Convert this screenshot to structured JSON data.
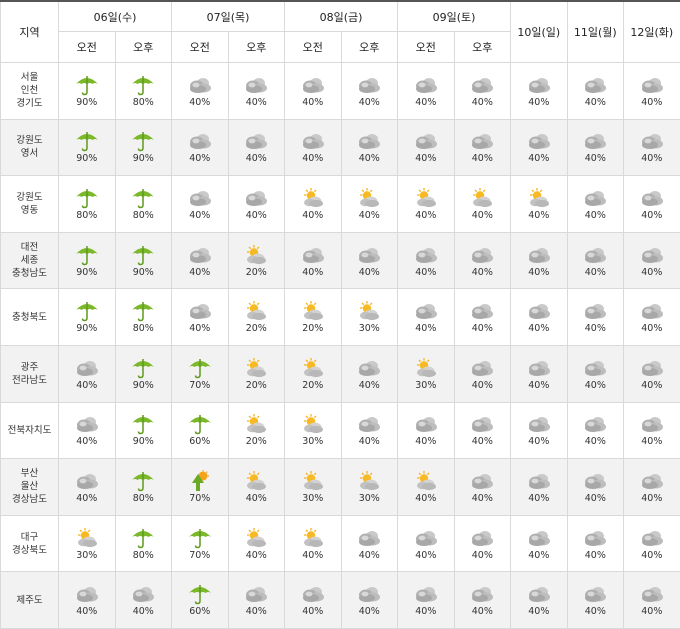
{
  "header": {
    "region_label": "지역",
    "days_am_pm": [
      "06일(수)",
      "07일(목)",
      "08일(금)",
      "09일(토)"
    ],
    "am_label": "오전",
    "pm_label": "오후",
    "days_single": [
      "10일(일)",
      "11일(월)",
      "12일(화)"
    ]
  },
  "icon_names": {
    "rain": "umbrella-rain-icon",
    "cloud": "cloudy-icon",
    "partly": "partly-cloudy-icon",
    "shower": "rain-shower-icon"
  },
  "colors": {
    "rain": "#7bb82a",
    "sun": "#f5b21c",
    "cloud": "#b5b5b5"
  },
  "rows": [
    {
      "region": [
        "서울",
        "인천",
        "경기도"
      ],
      "cells": [
        {
          "icon": "rain",
          "pct": "90%"
        },
        {
          "icon": "rain",
          "pct": "80%"
        },
        {
          "icon": "cloud",
          "pct": "40%"
        },
        {
          "icon": "cloud",
          "pct": "40%"
        },
        {
          "icon": "cloud",
          "pct": "40%"
        },
        {
          "icon": "cloud",
          "pct": "40%"
        },
        {
          "icon": "cloud",
          "pct": "40%"
        },
        {
          "icon": "cloud",
          "pct": "40%"
        },
        {
          "icon": "cloud",
          "pct": "40%"
        },
        {
          "icon": "cloud",
          "pct": "40%"
        },
        {
          "icon": "cloud",
          "pct": "40%"
        }
      ]
    },
    {
      "region": [
        "강원도",
        "영서"
      ],
      "cells": [
        {
          "icon": "rain",
          "pct": "90%"
        },
        {
          "icon": "rain",
          "pct": "90%"
        },
        {
          "icon": "cloud",
          "pct": "40%"
        },
        {
          "icon": "cloud",
          "pct": "40%"
        },
        {
          "icon": "cloud",
          "pct": "40%"
        },
        {
          "icon": "cloud",
          "pct": "40%"
        },
        {
          "icon": "cloud",
          "pct": "40%"
        },
        {
          "icon": "cloud",
          "pct": "40%"
        },
        {
          "icon": "cloud",
          "pct": "40%"
        },
        {
          "icon": "cloud",
          "pct": "40%"
        },
        {
          "icon": "cloud",
          "pct": "40%"
        }
      ]
    },
    {
      "region": [
        "강원도",
        "영동"
      ],
      "cells": [
        {
          "icon": "rain",
          "pct": "80%"
        },
        {
          "icon": "rain",
          "pct": "80%"
        },
        {
          "icon": "cloud",
          "pct": "40%"
        },
        {
          "icon": "cloud",
          "pct": "40%"
        },
        {
          "icon": "partly",
          "pct": "40%"
        },
        {
          "icon": "partly",
          "pct": "40%"
        },
        {
          "icon": "partly",
          "pct": "40%"
        },
        {
          "icon": "partly",
          "pct": "40%"
        },
        {
          "icon": "partly",
          "pct": "40%"
        },
        {
          "icon": "cloud",
          "pct": "40%"
        },
        {
          "icon": "cloud",
          "pct": "40%"
        }
      ]
    },
    {
      "region": [
        "대전",
        "세종",
        "충청남도"
      ],
      "cells": [
        {
          "icon": "rain",
          "pct": "90%"
        },
        {
          "icon": "rain",
          "pct": "90%"
        },
        {
          "icon": "cloud",
          "pct": "40%"
        },
        {
          "icon": "partly",
          "pct": "20%"
        },
        {
          "icon": "cloud",
          "pct": "40%"
        },
        {
          "icon": "cloud",
          "pct": "40%"
        },
        {
          "icon": "cloud",
          "pct": "40%"
        },
        {
          "icon": "cloud",
          "pct": "40%"
        },
        {
          "icon": "cloud",
          "pct": "40%"
        },
        {
          "icon": "cloud",
          "pct": "40%"
        },
        {
          "icon": "cloud",
          "pct": "40%"
        }
      ]
    },
    {
      "region": [
        "충청북도"
      ],
      "cells": [
        {
          "icon": "rain",
          "pct": "90%"
        },
        {
          "icon": "rain",
          "pct": "80%"
        },
        {
          "icon": "cloud",
          "pct": "40%"
        },
        {
          "icon": "partly",
          "pct": "20%"
        },
        {
          "icon": "partly",
          "pct": "20%"
        },
        {
          "icon": "partly",
          "pct": "30%"
        },
        {
          "icon": "cloud",
          "pct": "40%"
        },
        {
          "icon": "cloud",
          "pct": "40%"
        },
        {
          "icon": "cloud",
          "pct": "40%"
        },
        {
          "icon": "cloud",
          "pct": "40%"
        },
        {
          "icon": "cloud",
          "pct": "40%"
        }
      ]
    },
    {
      "region": [
        "광주",
        "전라남도"
      ],
      "cells": [
        {
          "icon": "cloud",
          "pct": "40%"
        },
        {
          "icon": "rain",
          "pct": "90%"
        },
        {
          "icon": "rain",
          "pct": "70%"
        },
        {
          "icon": "partly",
          "pct": "20%"
        },
        {
          "icon": "partly",
          "pct": "20%"
        },
        {
          "icon": "cloud",
          "pct": "40%"
        },
        {
          "icon": "partly",
          "pct": "30%"
        },
        {
          "icon": "cloud",
          "pct": "40%"
        },
        {
          "icon": "cloud",
          "pct": "40%"
        },
        {
          "icon": "cloud",
          "pct": "40%"
        },
        {
          "icon": "cloud",
          "pct": "40%"
        }
      ]
    },
    {
      "region": [
        "전북자치도"
      ],
      "cells": [
        {
          "icon": "cloud",
          "pct": "40%"
        },
        {
          "icon": "rain",
          "pct": "90%"
        },
        {
          "icon": "rain",
          "pct": "60%"
        },
        {
          "icon": "partly",
          "pct": "20%"
        },
        {
          "icon": "partly",
          "pct": "30%"
        },
        {
          "icon": "cloud",
          "pct": "40%"
        },
        {
          "icon": "cloud",
          "pct": "40%"
        },
        {
          "icon": "cloud",
          "pct": "40%"
        },
        {
          "icon": "cloud",
          "pct": "40%"
        },
        {
          "icon": "cloud",
          "pct": "40%"
        },
        {
          "icon": "cloud",
          "pct": "40%"
        }
      ]
    },
    {
      "region": [
        "부산",
        "울산",
        "경상남도"
      ],
      "cells": [
        {
          "icon": "cloud",
          "pct": "40%"
        },
        {
          "icon": "rain",
          "pct": "80%"
        },
        {
          "icon": "shower",
          "pct": "70%"
        },
        {
          "icon": "partly",
          "pct": "40%"
        },
        {
          "icon": "partly",
          "pct": "30%"
        },
        {
          "icon": "partly",
          "pct": "30%"
        },
        {
          "icon": "partly",
          "pct": "40%"
        },
        {
          "icon": "cloud",
          "pct": "40%"
        },
        {
          "icon": "cloud",
          "pct": "40%"
        },
        {
          "icon": "cloud",
          "pct": "40%"
        },
        {
          "icon": "cloud",
          "pct": "40%"
        }
      ]
    },
    {
      "region": [
        "대구",
        "경상북도"
      ],
      "cells": [
        {
          "icon": "partly",
          "pct": "30%"
        },
        {
          "icon": "rain",
          "pct": "80%"
        },
        {
          "icon": "rain",
          "pct": "70%"
        },
        {
          "icon": "partly",
          "pct": "40%"
        },
        {
          "icon": "partly",
          "pct": "40%"
        },
        {
          "icon": "cloud",
          "pct": "40%"
        },
        {
          "icon": "cloud",
          "pct": "40%"
        },
        {
          "icon": "cloud",
          "pct": "40%"
        },
        {
          "icon": "cloud",
          "pct": "40%"
        },
        {
          "icon": "cloud",
          "pct": "40%"
        },
        {
          "icon": "cloud",
          "pct": "40%"
        }
      ]
    },
    {
      "region": [
        "제주도"
      ],
      "cells": [
        {
          "icon": "cloud",
          "pct": "40%"
        },
        {
          "icon": "cloud",
          "pct": "40%"
        },
        {
          "icon": "rain",
          "pct": "60%"
        },
        {
          "icon": "cloud",
          "pct": "40%"
        },
        {
          "icon": "cloud",
          "pct": "40%"
        },
        {
          "icon": "cloud",
          "pct": "40%"
        },
        {
          "icon": "cloud",
          "pct": "40%"
        },
        {
          "icon": "cloud",
          "pct": "40%"
        },
        {
          "icon": "cloud",
          "pct": "40%"
        },
        {
          "icon": "cloud",
          "pct": "40%"
        },
        {
          "icon": "cloud",
          "pct": "40%"
        }
      ]
    }
  ]
}
